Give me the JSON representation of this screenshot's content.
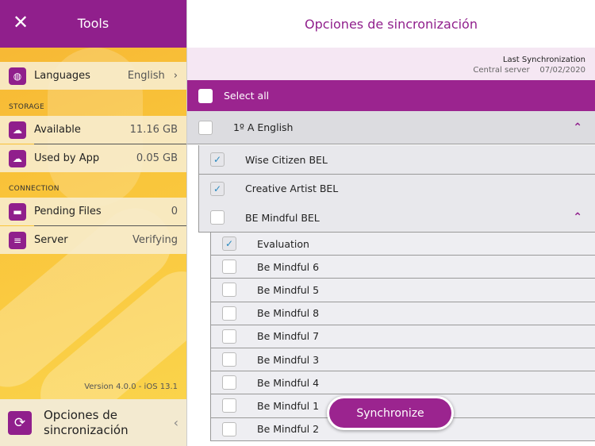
{
  "sidebar": {
    "title": "Tools",
    "languages_label": "Languages",
    "languages_value": "English",
    "storage_header": "STORAGE",
    "available_label": "Available",
    "available_value": "11.16 GB",
    "used_label": "Used by App",
    "used_value": "0.05 GB",
    "connection_header": "CONNECTION",
    "pending_label": "Pending Files",
    "pending_value": "0",
    "server_label": "Server",
    "server_value": "Verifying",
    "version": "Version 4.0.0 - iOS 13.1",
    "bottom_label": "Opciones de sincronización"
  },
  "main": {
    "title": "Opciones de sincronización",
    "last_sync_label": "Last Synchronization",
    "server_label": "Central server",
    "date": "07/02/2020",
    "select_all": "Select all",
    "group": "1º A English",
    "level2": [
      {
        "label": "Wise Citizen BEL",
        "checked": true
      },
      {
        "label": "Creative Artist BEL",
        "checked": true
      },
      {
        "label": "BE Mindful BEL",
        "checked": false
      }
    ],
    "level3": [
      {
        "label": "Evaluation",
        "checked": true
      },
      {
        "label": "Be Mindful 6",
        "checked": false
      },
      {
        "label": "Be Mindful 5",
        "checked": false
      },
      {
        "label": "Be Mindful 8",
        "checked": false
      },
      {
        "label": "Be Mindful 7",
        "checked": false
      },
      {
        "label": "Be Mindful 3",
        "checked": false
      },
      {
        "label": "Be Mindful 4",
        "checked": false
      },
      {
        "label": "Be Mindful 1",
        "checked": false
      },
      {
        "label": "Be Mindful 2",
        "checked": false
      }
    ],
    "sync_button": "Synchronize"
  },
  "colors": {
    "brand": "#901f8c",
    "check": "#2a8ac0"
  }
}
